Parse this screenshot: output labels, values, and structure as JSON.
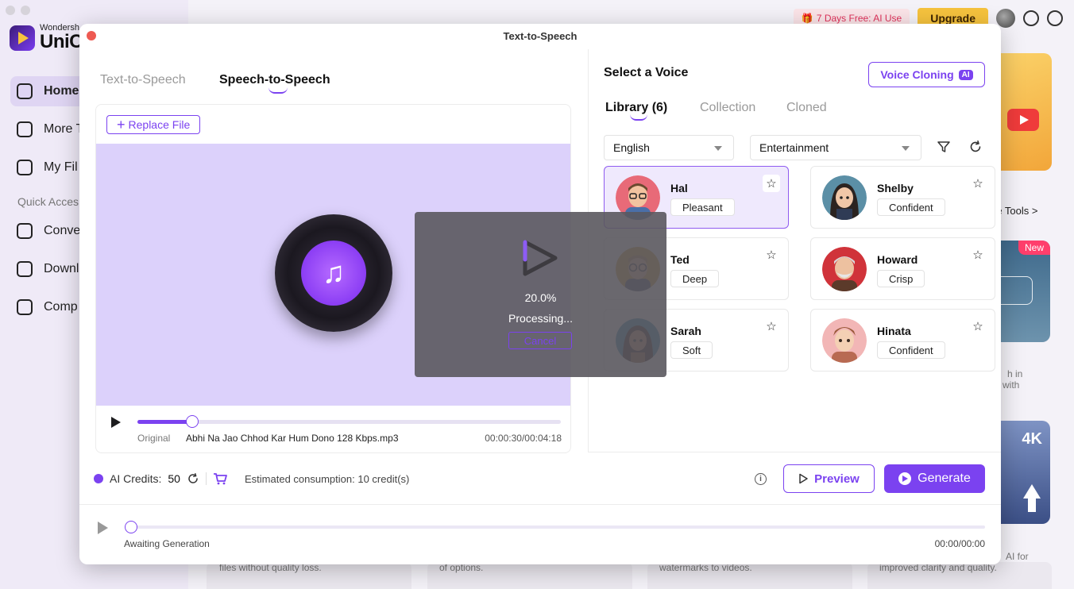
{
  "app": {
    "brand_small": "Wondersh",
    "brand_big": "UniCo",
    "sidebar": [
      {
        "label": "Home"
      },
      {
        "label": "More T"
      },
      {
        "label": "My Fil"
      },
      {
        "label": "Conve"
      },
      {
        "label": "Downl"
      },
      {
        "label": "Comp"
      }
    ],
    "quick_access": "Quick Acces",
    "promo": "7 Days Free: AI Use",
    "upgrade": "Upgrade",
    "more_tools": "re Tools >",
    "badge_new": "New",
    "badge_4k": "4K",
    "bg_texts": {
      "t1": "h in",
      "t2": "with",
      "t3": "AI for",
      "t4": "improved clarity and quality.",
      "t5": "files without quality loss.",
      "t6": "of options.",
      "t7": "watermarks to videos."
    }
  },
  "modal": {
    "title": "Text-to-Speech",
    "tabs": [
      {
        "label": "Text-to-Speech",
        "active": false
      },
      {
        "label": "Speech-to-Speech",
        "active": true
      }
    ],
    "replace_file": "Replace File",
    "player": {
      "original_label": "Original",
      "file_name": "Abhi Na Jao Chhod Kar Hum Dono 128 Kbps.mp3",
      "time": "00:00:30/00:04:18",
      "progress": 0.13
    },
    "processing": {
      "percent": "20.0%",
      "status": "Processing...",
      "cancel": "Cancel"
    },
    "voice_panel": {
      "title": "Select a Voice",
      "cloning_label": "Voice Cloning",
      "ai_chip": "AI",
      "tabs": [
        {
          "label": "Library (6)",
          "active": true
        },
        {
          "label": "Collection",
          "active": false
        },
        {
          "label": "Cloned",
          "active": false
        }
      ],
      "language": "English",
      "category": "Entertainment",
      "voices": [
        {
          "name": "Hal",
          "tag": "Pleasant",
          "selected": true
        },
        {
          "name": "Shelby",
          "tag": "Confident",
          "selected": false
        },
        {
          "name": "Ted",
          "tag": "Deep",
          "selected": false
        },
        {
          "name": "Howard",
          "tag": "Crisp",
          "selected": false
        },
        {
          "name": "Sarah",
          "tag": "Soft",
          "selected": false
        },
        {
          "name": "Hinata",
          "tag": "Confident",
          "selected": false
        }
      ]
    },
    "credits": {
      "label": "AI Credits:",
      "value": "50",
      "estimate": "Estimated consumption: 10 credit(s)"
    },
    "preview": "Preview",
    "generate": "Generate",
    "output": {
      "status": "Awaiting Generation",
      "time": "00:00/00:00"
    }
  },
  "colors": {
    "accent": "#7b42f0",
    "media_bg": "#dcd1fb",
    "selected_card": "#efe9fd",
    "upgrade": "#f6c33e",
    "promo_text": "#e0315a"
  }
}
